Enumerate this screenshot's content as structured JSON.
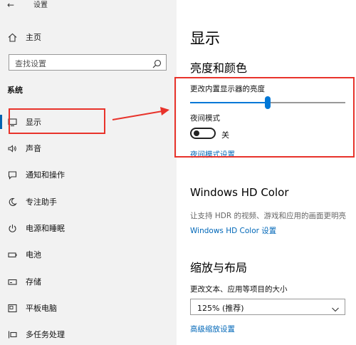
{
  "window": {
    "title": "设置"
  },
  "sidebar": {
    "home_label": "主页",
    "search_placeholder": "查找设置",
    "section_label": "系统",
    "items": [
      {
        "label": "显示",
        "icon": "monitor-icon",
        "active": true
      },
      {
        "label": "声音",
        "icon": "speaker-icon"
      },
      {
        "label": "通知和操作",
        "icon": "message-icon"
      },
      {
        "label": "专注助手",
        "icon": "moon-icon"
      },
      {
        "label": "电源和睡眠",
        "icon": "power-icon"
      },
      {
        "label": "电池",
        "icon": "battery-icon"
      },
      {
        "label": "存储",
        "icon": "storage-icon"
      },
      {
        "label": "平板电脑",
        "icon": "tablet-icon"
      },
      {
        "label": "多任务处理",
        "icon": "multitask-icon"
      }
    ]
  },
  "main": {
    "title": "显示",
    "brightness_section": {
      "heading": "亮度和颜色",
      "brightness_label": "更改内置显示器的亮度",
      "brightness_level_percent": 50,
      "night_light_label": "夜间模式",
      "night_light_state": "关",
      "night_light_settings_link": "夜间模式设置"
    },
    "hd_color_section": {
      "heading": "Windows HD Color",
      "description": "让支持 HDR 的视频、游戏和应用的画面更明亮",
      "settings_link": "Windows HD Color 设置"
    },
    "scale_section": {
      "heading": "缩放与布局",
      "scale_label": "更改文本、应用等项目的大小",
      "scale_value": "125% (推荐)",
      "advanced_link": "高级缩放设置"
    }
  },
  "colors": {
    "accent": "#0078d7",
    "link": "#0067b8",
    "annotation": "#e8332b"
  }
}
